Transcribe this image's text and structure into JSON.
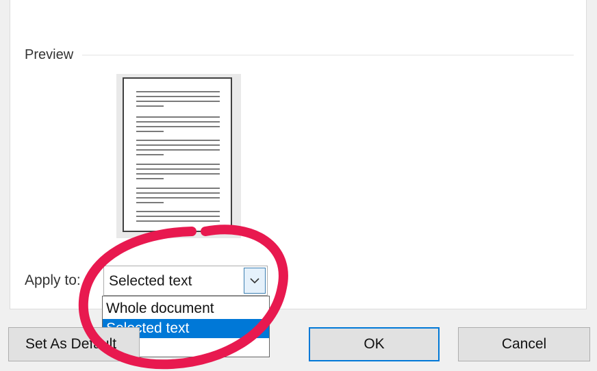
{
  "preview": {
    "label": "Preview"
  },
  "apply_to": {
    "label": "Apply to:",
    "value": "Selected text",
    "options": [
      "Whole document",
      "Selected text"
    ]
  },
  "buttons": {
    "set_as_default": "Set As Default",
    "ok": "OK",
    "cancel": "Cancel"
  },
  "colors": {
    "highlight": "#0078d7",
    "annotation": "#e8194f"
  }
}
